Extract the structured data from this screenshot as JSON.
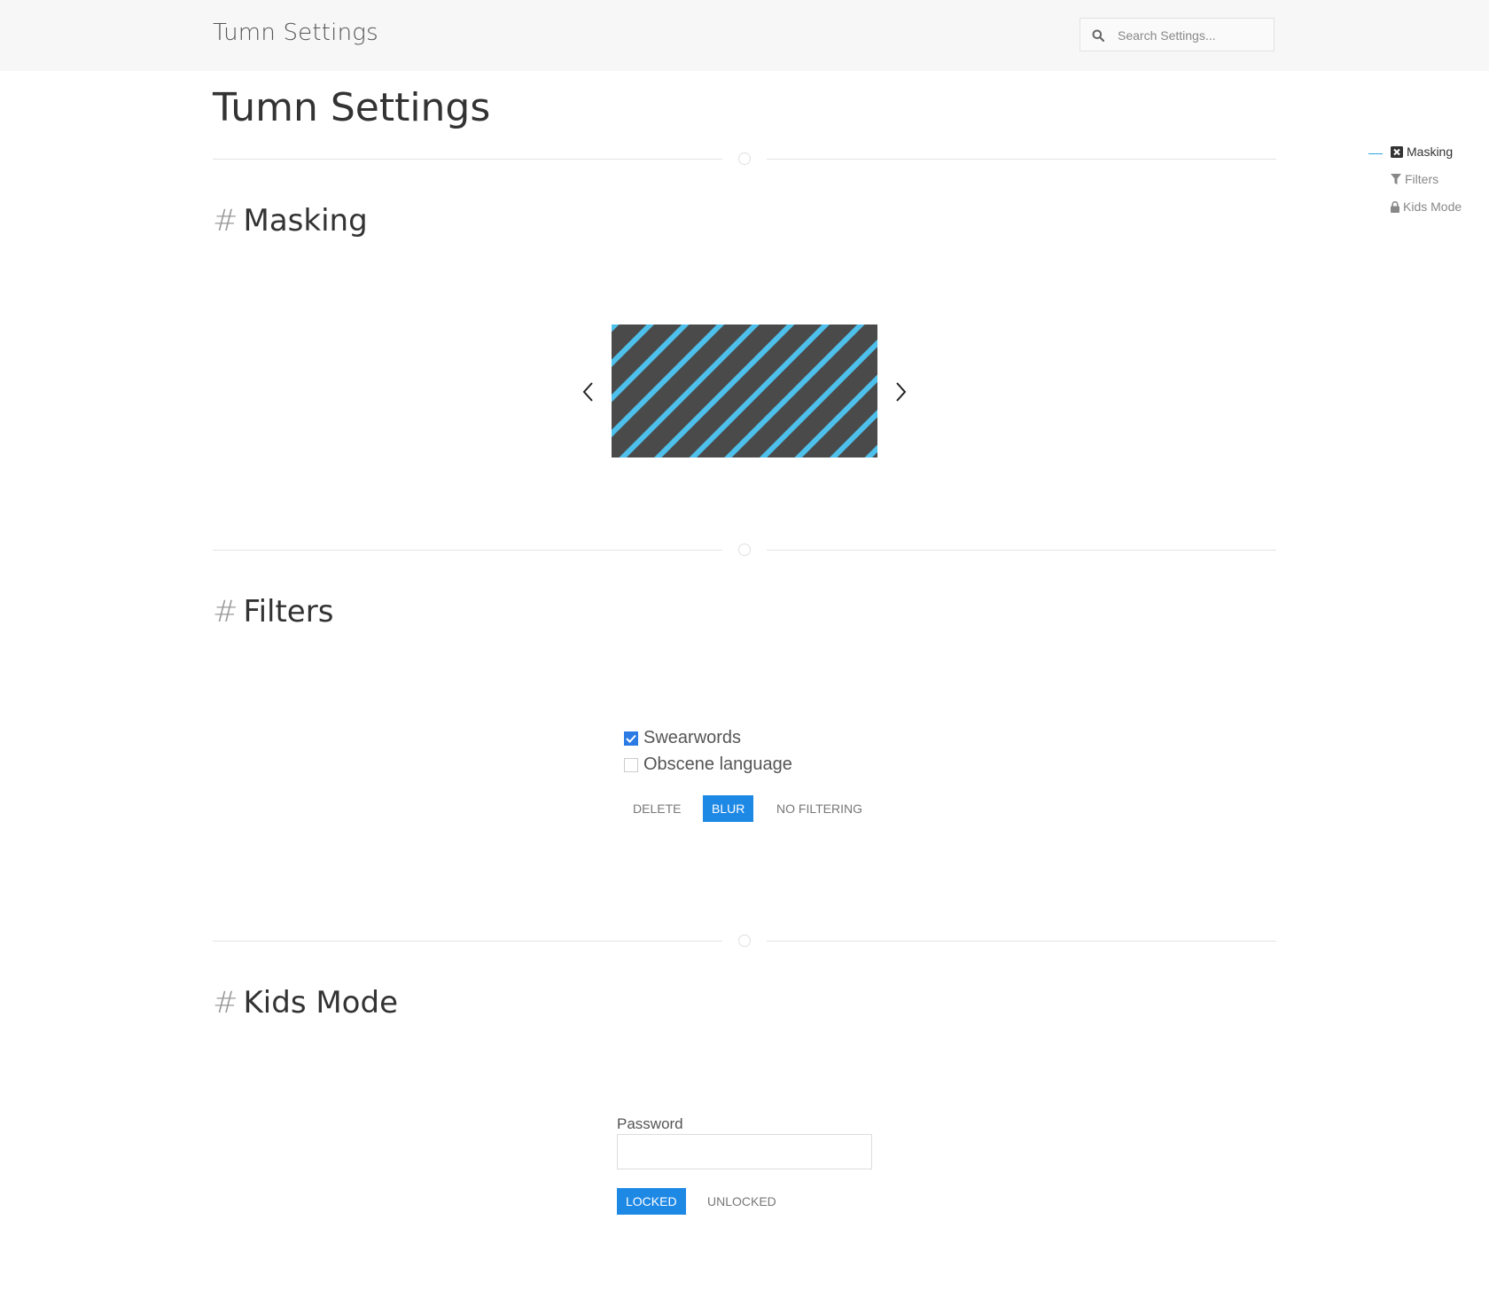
{
  "header": {
    "brand": "Tumn Settings",
    "search_placeholder": "Search Settings...",
    "search_value": ""
  },
  "page": {
    "title": "Tumn Settings"
  },
  "toc": {
    "items": [
      {
        "label": "Masking",
        "icon": "close-square-icon",
        "active": true
      },
      {
        "label": "Filters",
        "icon": "filter-icon",
        "active": false
      },
      {
        "label": "Kids Mode",
        "icon": "lock-icon",
        "active": false
      }
    ]
  },
  "masking": {
    "hash": "#",
    "title": "Masking",
    "pattern_colors": {
      "background": "#4a4a4a",
      "stripe": "#4ec0ec"
    }
  },
  "filters": {
    "hash": "#",
    "title": "Filters",
    "options": [
      {
        "label": "Swearwords",
        "checked": true
      },
      {
        "label": "Obscene language",
        "checked": false
      }
    ],
    "modes": [
      {
        "label": "DELETE",
        "selected": false
      },
      {
        "label": "BLUR",
        "selected": true
      },
      {
        "label": "NO FILTERING",
        "selected": false
      }
    ]
  },
  "kids_mode": {
    "hash": "#",
    "title": "Kids Mode",
    "password_label": "Password",
    "password_value": "",
    "states": [
      {
        "label": "LOCKED",
        "selected": true
      },
      {
        "label": "UNLOCKED",
        "selected": false
      }
    ]
  },
  "colors": {
    "accent": "#1e88e5",
    "toc_indicator": "#2aa6e0",
    "topbar_bg": "#f7f7f7"
  }
}
